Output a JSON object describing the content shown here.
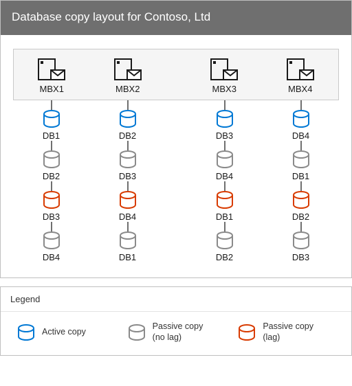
{
  "title": "Database copy layout for Contoso, Ltd",
  "servers": [
    {
      "name": "MBX1",
      "copies": [
        {
          "db": "DB1",
          "type": "active"
        },
        {
          "db": "DB2",
          "type": "passive"
        },
        {
          "db": "DB3",
          "type": "lag"
        },
        {
          "db": "DB4",
          "type": "passive"
        }
      ]
    },
    {
      "name": "MBX2",
      "copies": [
        {
          "db": "DB2",
          "type": "active"
        },
        {
          "db": "DB3",
          "type": "passive"
        },
        {
          "db": "DB4",
          "type": "lag"
        },
        {
          "db": "DB1",
          "type": "passive"
        }
      ]
    },
    {
      "name": "MBX3",
      "copies": [
        {
          "db": "DB3",
          "type": "active"
        },
        {
          "db": "DB4",
          "type": "passive"
        },
        {
          "db": "DB1",
          "type": "lag"
        },
        {
          "db": "DB2",
          "type": "passive"
        }
      ]
    },
    {
      "name": "MBX4",
      "copies": [
        {
          "db": "DB4",
          "type": "active"
        },
        {
          "db": "DB1",
          "type": "passive"
        },
        {
          "db": "DB2",
          "type": "lag"
        },
        {
          "db": "DB3",
          "type": "passive"
        }
      ]
    }
  ],
  "legend": {
    "heading": "Legend",
    "items": [
      {
        "type": "active",
        "label": "Active copy"
      },
      {
        "type": "passive",
        "label": "Passive copy\n(no lag)"
      },
      {
        "type": "lag",
        "label": "Passive copy\n(lag)"
      }
    ]
  },
  "colors": {
    "active": "#0078d4",
    "passive": "#8a8a8a",
    "lag": "#d83b01",
    "ink": "#1a1a1a"
  }
}
